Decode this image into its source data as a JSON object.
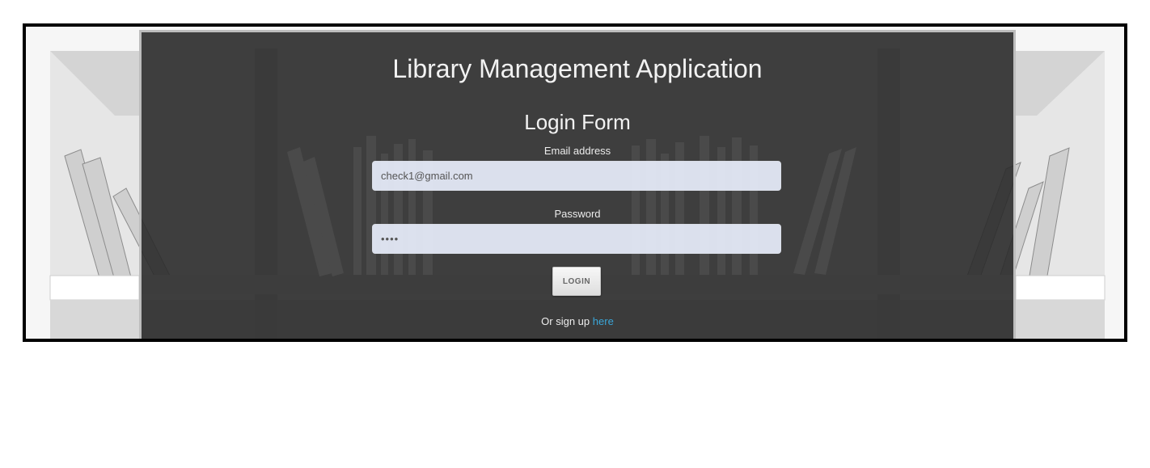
{
  "header": {
    "app_title": "Library Management Application"
  },
  "login_form": {
    "title": "Login Form",
    "email_label": "Email address",
    "email_value": "check1@gmail.com",
    "password_label": "Password",
    "password_value": "••••",
    "login_button": "LOGIN",
    "signup_prefix": "Or sign up",
    "signup_link": "here"
  },
  "colors": {
    "panel_overlay": "#282828",
    "link": "#3aa6d8",
    "input_bg": "#e8eefc"
  }
}
